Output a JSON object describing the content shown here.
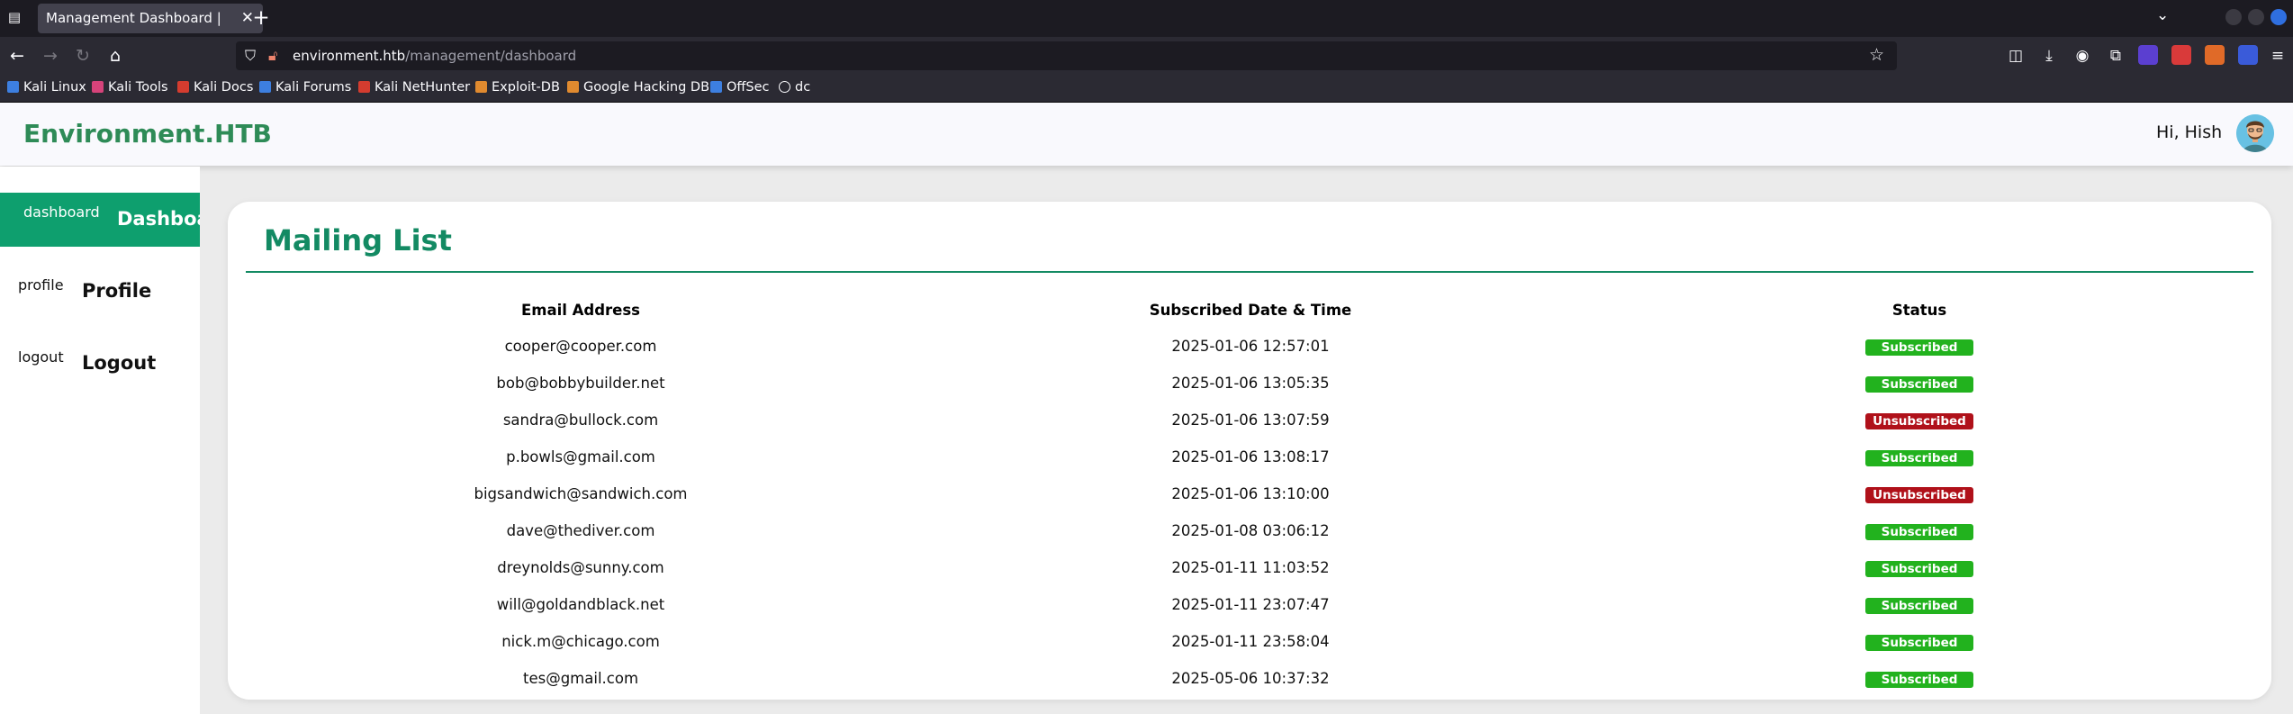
{
  "browser": {
    "tab": {
      "title": "Management Dashboard | env",
      "close": "✕"
    },
    "new_tab": "+",
    "url": {
      "host": "environment.htb",
      "path": "/management/dashboard"
    },
    "bookmarks": [
      {
        "label": "Kali Linux",
        "color": "#3d7fe0"
      },
      {
        "label": "Kali Tools",
        "color": "#d6437a"
      },
      {
        "label": "Kali Docs",
        "color": "#d43c2f"
      },
      {
        "label": "Kali Forums",
        "color": "#3d7fe0"
      },
      {
        "label": "Kali NetHunter",
        "color": "#d43c2f"
      },
      {
        "label": "Exploit-DB",
        "color": "#e08a2f"
      },
      {
        "label": "Google Hacking DB",
        "color": "#e08a2f"
      },
      {
        "label": "OffSec",
        "color": "#3d7fe0"
      },
      {
        "label": "dc",
        "color": "#aaaaaa"
      }
    ]
  },
  "header": {
    "brand": "Environment.HTB",
    "greeting": "Hi, Hish"
  },
  "sidebar": {
    "items": [
      {
        "alt": "dashboard",
        "label": "Dashboard",
        "active": true
      },
      {
        "alt": "profile",
        "label": "Profile",
        "active": false
      },
      {
        "alt": "logout",
        "label": "Logout",
        "active": false
      }
    ]
  },
  "mailing_list": {
    "title": "Mailing List",
    "columns": [
      "Email Address",
      "Subscribed Date & Time",
      "Status"
    ],
    "rows": [
      {
        "email": "cooper@cooper.com",
        "date": "2025-01-06 12:57:01",
        "status": "Subscribed"
      },
      {
        "email": "bob@bobbybuilder.net",
        "date": "2025-01-06 13:05:35",
        "status": "Subscribed"
      },
      {
        "email": "sandra@bullock.com",
        "date": "2025-01-06 13:07:59",
        "status": "Unsubscribed"
      },
      {
        "email": "p.bowls@gmail.com",
        "date": "2025-01-06 13:08:17",
        "status": "Subscribed"
      },
      {
        "email": "bigsandwich@sandwich.com",
        "date": "2025-01-06 13:10:00",
        "status": "Unsubscribed"
      },
      {
        "email": "dave@thediver.com",
        "date": "2025-01-08 03:06:12",
        "status": "Subscribed"
      },
      {
        "email": "dreynolds@sunny.com",
        "date": "2025-01-11 11:03:52",
        "status": "Subscribed"
      },
      {
        "email": "will@goldandblack.net",
        "date": "2025-01-11 23:07:47",
        "status": "Subscribed"
      },
      {
        "email": "nick.m@chicago.com",
        "date": "2025-01-11 23:58:04",
        "status": "Subscribed"
      },
      {
        "email": "tes@gmail.com",
        "date": "2025-05-06 10:37:32",
        "status": "Subscribed"
      }
    ]
  },
  "colors": {
    "brand": "#2e8b57",
    "active_nav": "#0e9f6e",
    "subscribed": "#22b21e",
    "unsubscribed": "#b0111a"
  }
}
